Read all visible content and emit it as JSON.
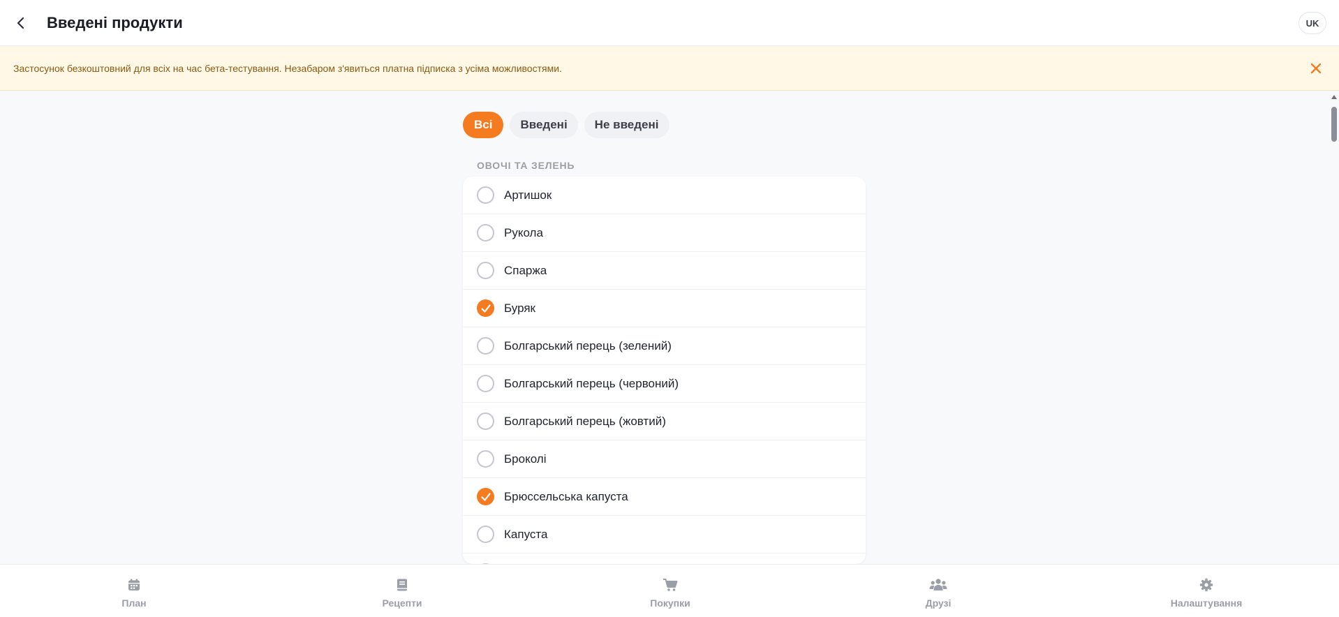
{
  "header": {
    "title": "Введені продукти",
    "back_icon": "chevron-left-icon",
    "language": "UK"
  },
  "banner": {
    "text": "Застосунок безкоштовний для всіх на час бета-тестування. Незабаром з'явиться платна підписка з усіма можливостями.",
    "close_icon": "close-icon",
    "color": "#f47b20"
  },
  "filters": {
    "tabs": [
      {
        "label": "Всі",
        "active": true
      },
      {
        "label": "Введені",
        "active": false
      },
      {
        "label": "Не введені",
        "active": false
      }
    ]
  },
  "section": {
    "title": "ОВОЧІ ТА ЗЕЛЕНЬ",
    "items": [
      {
        "label": "Артишок",
        "checked": false
      },
      {
        "label": "Рукола",
        "checked": false
      },
      {
        "label": "Спаржа",
        "checked": false
      },
      {
        "label": "Буряк",
        "checked": true
      },
      {
        "label": "Болгарський перець (зелений)",
        "checked": false
      },
      {
        "label": "Болгарський перець (червоний)",
        "checked": false
      },
      {
        "label": "Болгарський перець (жовтий)",
        "checked": false
      },
      {
        "label": "Броколі",
        "checked": false
      },
      {
        "label": "Брюссельська капуста",
        "checked": true
      },
      {
        "label": "Капуста",
        "checked": false
      },
      {
        "label": "",
        "checked": false
      }
    ]
  },
  "bottom_nav": {
    "items": [
      {
        "label": "План",
        "icon": "calendar-icon"
      },
      {
        "label": "Рецепти",
        "icon": "book-icon"
      },
      {
        "label": "Покупки",
        "icon": "cart-icon"
      },
      {
        "label": "Друзі",
        "icon": "users-icon"
      },
      {
        "label": "Налаштування",
        "icon": "gear-icon"
      }
    ]
  },
  "colors": {
    "accent": "#f47b20",
    "banner_bg": "#fff8e6",
    "nav_icon": "#9a9ea8"
  }
}
